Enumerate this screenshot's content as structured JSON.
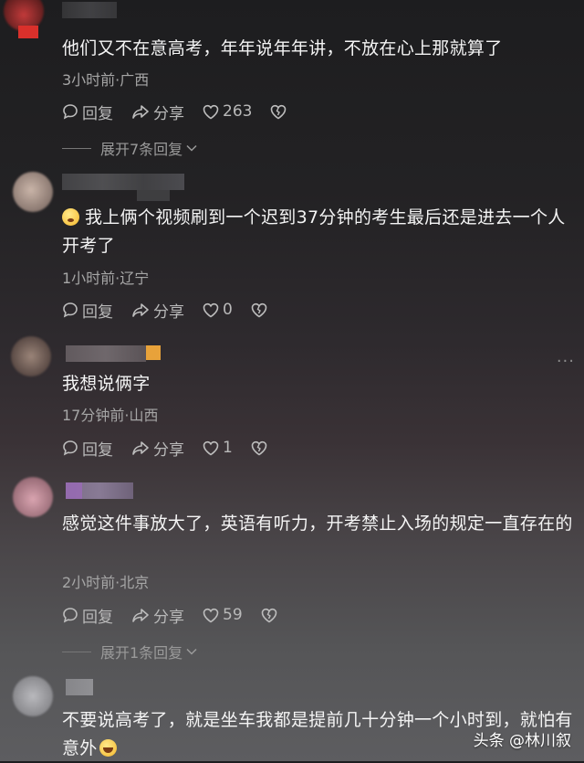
{
  "comments": [
    {
      "text": "他们又不在意高考，年年说年年讲，不放在心上那就算了",
      "meta": "3小时前·广西",
      "reply_label": "回复",
      "share_label": "分享",
      "likes": "263",
      "expand_label": "展开7条回复"
    },
    {
      "text": "我上俩个视频刷到一个迟到37分钟的考生最后还是进去一个人开考了",
      "meta": "1小时前·辽宁",
      "reply_label": "回复",
      "share_label": "分享",
      "likes": "0"
    },
    {
      "text": "我想说俩字",
      "meta": "17分钟前·山西",
      "reply_label": "回复",
      "share_label": "分享",
      "likes": "1"
    },
    {
      "text": "感觉这件事放大了，英语有听力，开考禁止入场的规定一直存在的",
      "meta": "2小时前·北京",
      "reply_label": "回复",
      "share_label": "分享",
      "likes": "59",
      "expand_label": "展开1条回复"
    },
    {
      "text": "不要说高考了，就是坐车我都是提前几十分钟一个小时到，就怕有意外"
    }
  ],
  "watermark": {
    "platform": "头条",
    "author": "@林川叙"
  },
  "icons": {
    "reply": "chat-bubble-icon",
    "share": "share-arrow-icon",
    "like": "heart-icon",
    "dislike": "broken-heart-icon",
    "more": "more-dots-icon"
  }
}
